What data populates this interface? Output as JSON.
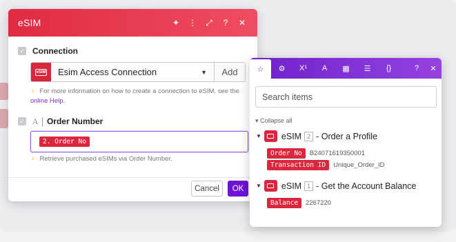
{
  "dialog": {
    "title": "eSIM",
    "header_icons": [
      "sparkle-icon",
      "more-icon",
      "expand-icon",
      "help-icon",
      "close-icon"
    ],
    "header_icon_glyphs": [
      "✦",
      "⋮",
      "⤢",
      "?",
      "✕"
    ],
    "connection": {
      "label": "Connection",
      "selected": "Esim Access Connection",
      "add_label": "Add",
      "logo_text": "eSIM",
      "hint_text": "For more information on how to create a connection to eSIM, see the ",
      "hint_link": "online Help",
      "hint_end": "."
    },
    "order_number": {
      "label": "Order Number",
      "type_glyph": "A",
      "value_pill": "2. Order No",
      "hint_text": "Retrieve purchased eSIMs via Order Number."
    },
    "cancel_label": "Cancel",
    "ok_label": "OK"
  },
  "panel": {
    "tabs": [
      {
        "name": "favorites-tab",
        "glyph": "☆",
        "active": true
      },
      {
        "name": "settings-tab",
        "glyph": "⚙",
        "active": false
      },
      {
        "name": "math-tab",
        "glyph": "X¹",
        "active": false
      },
      {
        "name": "text-tab",
        "glyph": "A",
        "active": false
      },
      {
        "name": "date-tab",
        "glyph": "▦",
        "active": false
      },
      {
        "name": "array-tab",
        "glyph": "☰",
        "active": false
      },
      {
        "name": "general-tab",
        "glyph": "{}",
        "active": false
      }
    ],
    "help_glyph": "?",
    "close_glyph": "✕",
    "search_placeholder": "Search items",
    "collapse_label": "Collapse all",
    "modules": [
      {
        "app": "eSIM",
        "index": "2",
        "title": "- Order a Profile",
        "fields": [
          {
            "name": "Order No",
            "value": "B24071619350001"
          },
          {
            "name": "Transaction ID",
            "value": "Unique_Order_ID"
          }
        ]
      },
      {
        "app": "eSIM",
        "index": "1",
        "title": "- Get the Account Balance",
        "fields": [
          {
            "name": "Balance",
            "value": "2267220"
          }
        ]
      }
    ]
  },
  "colors": {
    "brand_red": "#e02b43",
    "accent_purple": "#6d12d6",
    "pill_red": "#d9283d"
  }
}
